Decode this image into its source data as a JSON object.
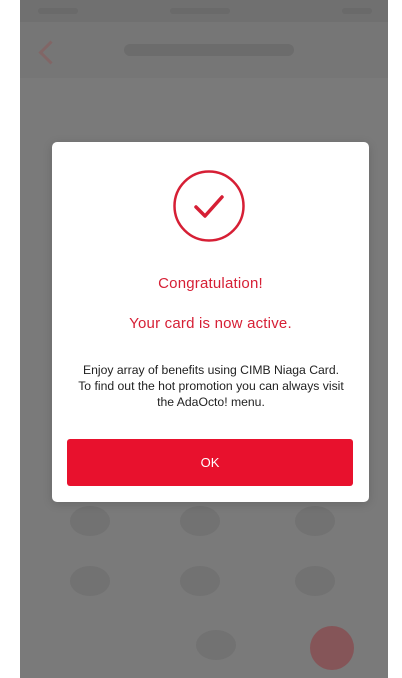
{
  "dialog": {
    "title": "Congratulation!",
    "subtitle": "Your card is now active.",
    "body": "Enjoy array of benefits using CIMB Niaga Card. To find out the hot promotion you can always visit the AdaOcto! menu.",
    "ok_label": "OK",
    "icon": "check-circle-icon"
  },
  "colors": {
    "accent": "#d61f35",
    "button": "#e8112d",
    "overlay": "#7a7a7a",
    "dialog_bg": "#ffffff"
  }
}
